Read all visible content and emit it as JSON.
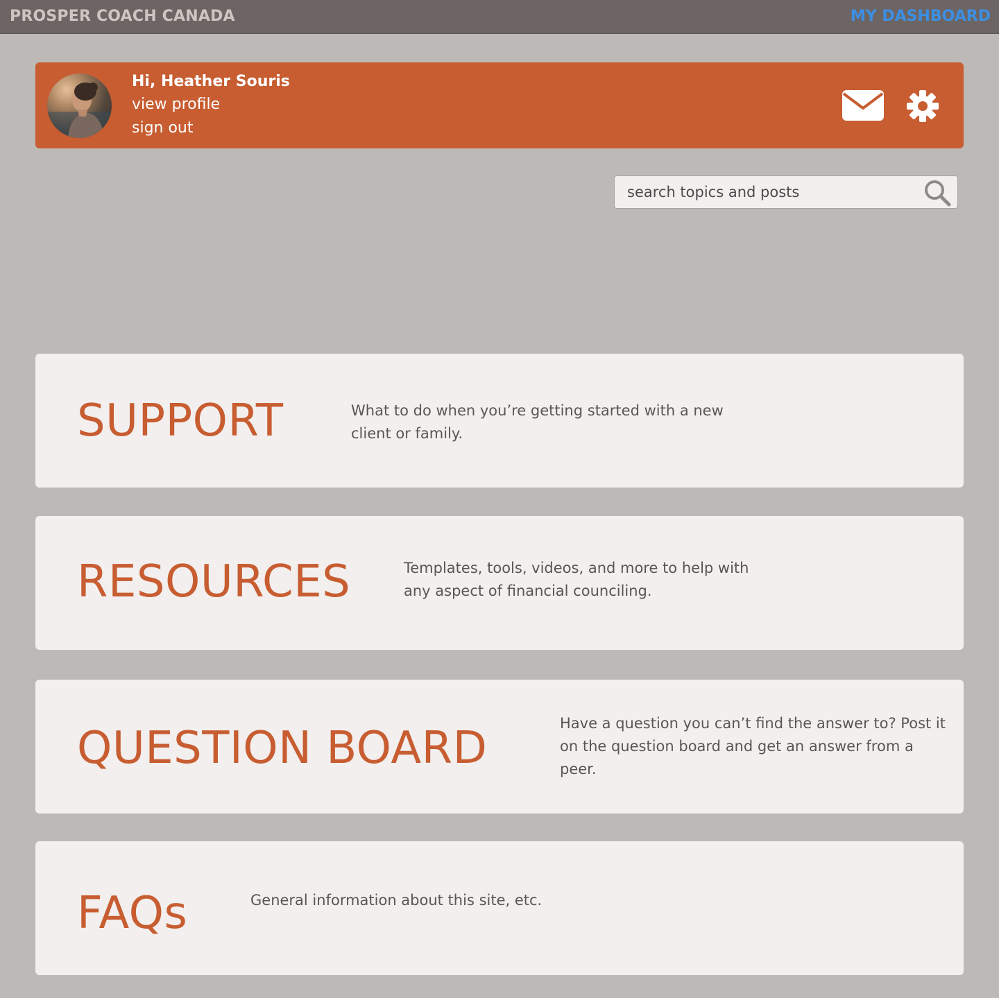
{
  "topbar": {
    "brand": "PROSPER COACH CANADA",
    "dashboard_link": "MY DASHBOARD",
    "background_color": "#6d6564",
    "link_color": "#3c8fe3"
  },
  "user": {
    "greeting": "Hi, Heather Souris",
    "view_profile": "view profile",
    "sign_out": "sign out",
    "avatar_icon": "user-photo",
    "mail_icon": "envelope-icon",
    "settings_icon": "gear-icon"
  },
  "search": {
    "placeholder": "search topics and posts",
    "value": "",
    "icon": "magnifier-icon"
  },
  "theme": {
    "accent": "#c75d31",
    "card_background": "#f2efee",
    "page_background": "#bdb9b6"
  },
  "cards": [
    {
      "title": "SUPPORT",
      "description": "What to do when you’re getting started with a new client or family."
    },
    {
      "title": "RESOURCES",
      "description": "Templates, tools, videos, and more to help with any aspect of financial counciling."
    },
    {
      "title": "QUESTION BOARD",
      "description": "Have a question you can’t find the answer to? Post it on the question board and get an answer from a peer."
    },
    {
      "title": "FAQs",
      "description": "General information about this site, etc."
    }
  ]
}
